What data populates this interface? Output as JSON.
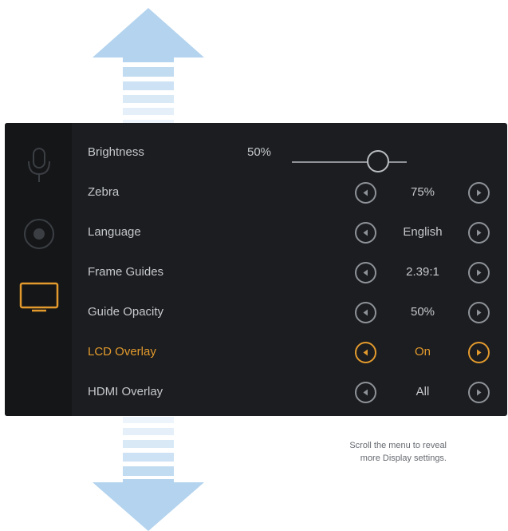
{
  "menu": {
    "rows": [
      {
        "label": "Brightness",
        "value": "50%"
      },
      {
        "label": "Zebra",
        "value": "75%"
      },
      {
        "label": "Language",
        "value": "English"
      },
      {
        "label": "Frame Guides",
        "value": "2.39:1"
      },
      {
        "label": "Guide Opacity",
        "value": "50%"
      },
      {
        "label": "LCD Overlay",
        "value": "On"
      },
      {
        "label": "HDMI Overlay",
        "value": "All"
      }
    ],
    "brightness_level": 0.5
  },
  "sidebar": {
    "items": [
      {
        "icon": "microphone-icon"
      },
      {
        "icon": "record-icon"
      },
      {
        "icon": "monitor-icon",
        "selected": true
      }
    ]
  },
  "caption": {
    "line1": "Scroll the menu to reveal",
    "line2": "more Display settings."
  },
  "colors": {
    "panel_bg": "#1b1d20",
    "accent": "#e39a2d",
    "arrow": "#b3d3ee",
    "text": "#c5c8cc"
  }
}
